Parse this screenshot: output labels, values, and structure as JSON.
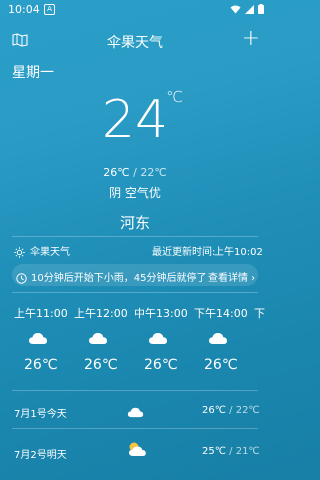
{
  "status_bar": {
    "time": "10:04",
    "notification_glyph": "A"
  },
  "header": {
    "title": "伞果天气",
    "add_label": "+"
  },
  "current": {
    "weekday": "星期一",
    "temperature": "24",
    "unit": "℃",
    "high": "26℃",
    "low": "22℃",
    "range_separator": " / ",
    "condition": "阴  空气优",
    "location": "河东"
  },
  "source": {
    "name": "伞果天气",
    "update_label": "最近更新时间:",
    "update_time": "上午10:02"
  },
  "notice": {
    "text": "10分钟后开始下小雨，45分钟后就停了",
    "link": "查看详情 ›"
  },
  "hourly": [
    {
      "time": "上午11:00",
      "temp": "26℃",
      "icon": "cloud-icon"
    },
    {
      "time": "上午12:00",
      "temp": "26℃",
      "icon": "cloud-icon"
    },
    {
      "time": "中午13:00",
      "temp": "26℃",
      "icon": "cloud-icon"
    },
    {
      "time": "下午14:00",
      "temp": "26℃",
      "icon": "cloud-icon"
    },
    {
      "time": "下"
    }
  ],
  "daily": [
    {
      "label": "7月1号今天",
      "high": "26℃",
      "low": "22℃",
      "separator": " / ",
      "icon": "cloud-icon"
    },
    {
      "label": "7月2号明天",
      "high": "25℃",
      "low": "21℃",
      "separator": " / ",
      "icon": "partly-cloudy-icon"
    }
  ]
}
